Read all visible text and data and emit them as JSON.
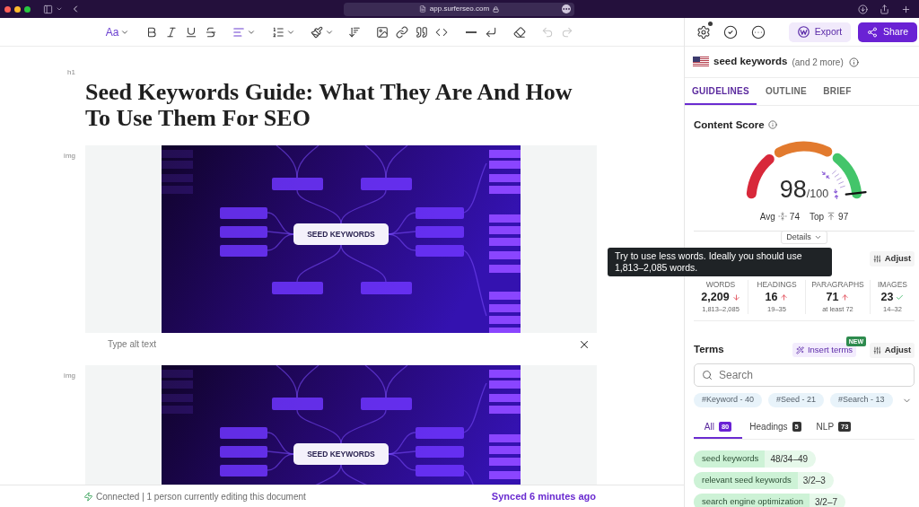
{
  "browser": {
    "url": "app.surferseo.com"
  },
  "toolbar": {
    "text_style": "Aa",
    "history": [
      {
        "kind": "undo",
        "disabled": true
      },
      {
        "kind": "redo",
        "disabled": true
      }
    ]
  },
  "header_actions": {
    "settings_badge": true,
    "buttons": [
      {
        "kind": "export",
        "label": "Export"
      },
      {
        "kind": "share",
        "label": "Share"
      }
    ]
  },
  "document": {
    "blocks": [
      {
        "kind": "heading",
        "tag": "h1",
        "text": "Seed Keywords Guide: What They Are And How To Use Them For SEO"
      },
      {
        "kind": "image",
        "tag": "img",
        "label": "SEED KEYWORDS",
        "alt_text": {
          "placeholder": "Type alt text"
        }
      },
      {
        "kind": "image",
        "tag": "img",
        "label": "SEED KEYWORDS"
      }
    ]
  },
  "status_bar": {
    "connection": "Connected | 1 person currently editing this document",
    "sync": "Synced 6 minutes ago"
  },
  "panel": {
    "keyword": {
      "main": "seed keywords",
      "more": "(and 2 more)"
    },
    "tabs": [
      {
        "label": "GUIDELINES",
        "selected": true
      },
      {
        "label": "OUTLINE",
        "selected": false
      },
      {
        "label": "BRIEF",
        "selected": false
      }
    ],
    "content_score": {
      "title": "Content Score",
      "score": "98",
      "max": "/100",
      "level": 0.98,
      "markers": [
        {
          "kind": "avg",
          "label": "Avg",
          "value": "74"
        },
        {
          "kind": "top",
          "label": "Top",
          "value": "97"
        }
      ],
      "details": "Details"
    },
    "tooltip": "Try to use less words. Ideally you should use 1,813–2,085 words.",
    "structure": {
      "adjust": "Adjust",
      "metrics": [
        {
          "kind": "decrease",
          "label": "WORDS",
          "value": "2,209",
          "range": "1,813–2,085"
        },
        {
          "kind": "increase",
          "label": "HEADINGS",
          "value": "16",
          "range": "19–35"
        },
        {
          "kind": "increase",
          "label": "PARAGRAPHS",
          "value": "71",
          "range": "at least 72"
        },
        {
          "kind": "ok",
          "label": "IMAGES",
          "value": "23",
          "range": "14–32"
        }
      ]
    },
    "terms": {
      "title": "Terms",
      "insert": "Insert terms",
      "badge": "NEW",
      "adjust": "Adjust",
      "search": {
        "placeholder": "Search"
      },
      "topics": [
        "#Keyword - 40",
        "#Seed - 21",
        "#Search - 13"
      ],
      "filters": [
        {
          "label": "All",
          "count": "80",
          "selected": true
        },
        {
          "label": "Headings",
          "count": "5",
          "selected": false
        },
        {
          "label": "NLP",
          "count": "73",
          "selected": false
        }
      ],
      "items": [
        {
          "term": "seed keywords",
          "count": "48/34–49"
        },
        {
          "term": "relevant seed keywords",
          "count": "3/2–3"
        },
        {
          "term": "search engine optimization",
          "count": "3/2–7"
        }
      ]
    }
  }
}
